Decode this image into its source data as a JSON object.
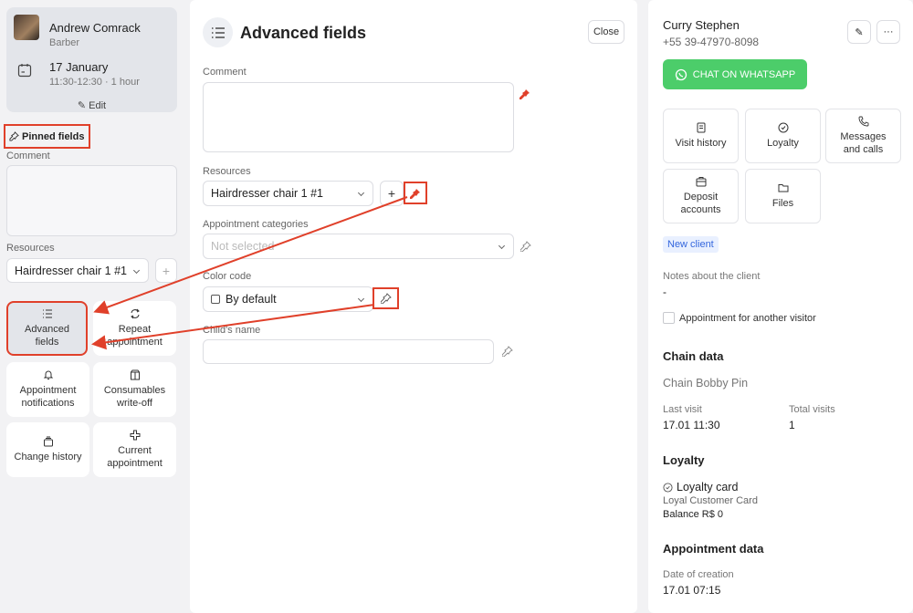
{
  "appointment": {
    "staff_name": "Andrew Comrack",
    "staff_role": "Barber",
    "date": "17 January",
    "time": "11:30-12:30 · 1 hour",
    "edit_label": "Edit"
  },
  "pinned": {
    "title": "Pinned fields",
    "comment_label": "Comment",
    "resources_label": "Resources",
    "resource_value": "Hairdresser chair 1 #1",
    "plus": "+"
  },
  "tiles": [
    {
      "label": "Advanced fields",
      "icon": "list-icon"
    },
    {
      "label": "Repeat appointment",
      "icon": "repeat-icon"
    },
    {
      "label": "Appointment notifications",
      "icon": "bell-icon"
    },
    {
      "label": "Consumables write-off",
      "icon": "box-icon"
    },
    {
      "label": "Change history",
      "icon": "history-icon"
    },
    {
      "label": "Current appointment",
      "icon": "plus-cross-icon"
    }
  ],
  "advanced": {
    "title": "Advanced fields",
    "close_label": "Close",
    "comment_label": "Comment",
    "resources_label": "Resources",
    "resource_value": "Hairdresser chair 1 #1",
    "plus": "+",
    "categories_label": "Appointment categories",
    "categories_placeholder": "Not selected",
    "color_label": "Color code",
    "color_value": "By default",
    "child_label": "Child's name"
  },
  "client": {
    "name": "Curry Stephen",
    "phone": "+55 39-47970-8098",
    "more": "···",
    "whatsapp_label": "CHAT ON WHATSAPP",
    "tiles": [
      {
        "label": "Visit history",
        "icon": "receipt-icon"
      },
      {
        "label": "Loyalty",
        "icon": "loyalty-icon"
      },
      {
        "label": "Messages and calls",
        "icon": "phone-icon"
      },
      {
        "label": "Deposit accounts",
        "icon": "wallet-icon"
      },
      {
        "label": "Files",
        "icon": "folder-icon"
      }
    ],
    "badge": "New client",
    "notes_label": "Notes about the client",
    "notes_value": "-",
    "another_visitor": "Appointment for another visitor",
    "chain_head": "Chain data",
    "chain_name": "Chain Bobby Pin",
    "last_visit_label": "Last visit",
    "last_visit_value": "17.01 11:30",
    "total_visits_label": "Total visits",
    "total_visits_value": "1",
    "loyalty_head": "Loyalty",
    "loyalty_card": "Loyalty card",
    "loyalty_card_name": "Loyal Customer Card",
    "balance": "Balance R$ 0",
    "appt_data_head": "Appointment data",
    "creation_label": "Date of creation",
    "creation_value": "17.01 07:15"
  },
  "colors": {
    "highlight": "#e0402a",
    "whatsapp": "#4ccd6a",
    "pin_active": "#e0402a"
  }
}
